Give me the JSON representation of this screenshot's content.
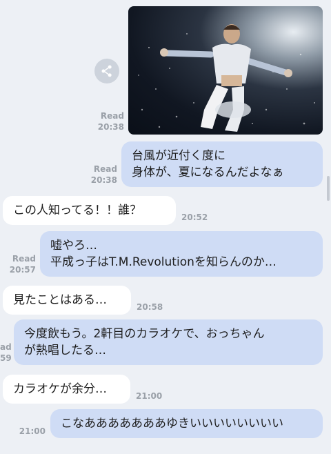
{
  "photo": {
    "alt": "concert-photo"
  },
  "share": {
    "icon": "share-icon"
  },
  "messages": [
    {
      "dir": "out",
      "type": "image",
      "read": "Read",
      "time": "20:38"
    },
    {
      "dir": "out",
      "lines": [
        "台風が近付く度に",
        "身体が、夏になるんだよなぁ"
      ],
      "read": "Read",
      "time": "20:38"
    },
    {
      "dir": "in",
      "lines": [
        "この人知ってる！！誰？"
      ],
      "time": "20:52"
    },
    {
      "dir": "out",
      "lines": [
        "嘘やろ…",
        "平成っ子はT.M.Revolutionを知らんのか…"
      ],
      "read": "Read",
      "time": "20:57"
    },
    {
      "dir": "in",
      "lines": [
        "見たことはある…"
      ],
      "time": "20:58"
    },
    {
      "dir": "out",
      "lines": [
        "今度飲もう。2軒目のカラオケで、おっちゃん",
        "が熱唱したる…"
      ],
      "read": "ad",
      "time": "59"
    },
    {
      "dir": "in",
      "lines": [
        "カラオケが余分…"
      ],
      "time": "21:00"
    },
    {
      "dir": "out",
      "lines": [
        "こなあああああああゆきいいいいいいいい"
      ],
      "time": "21:00"
    }
  ]
}
